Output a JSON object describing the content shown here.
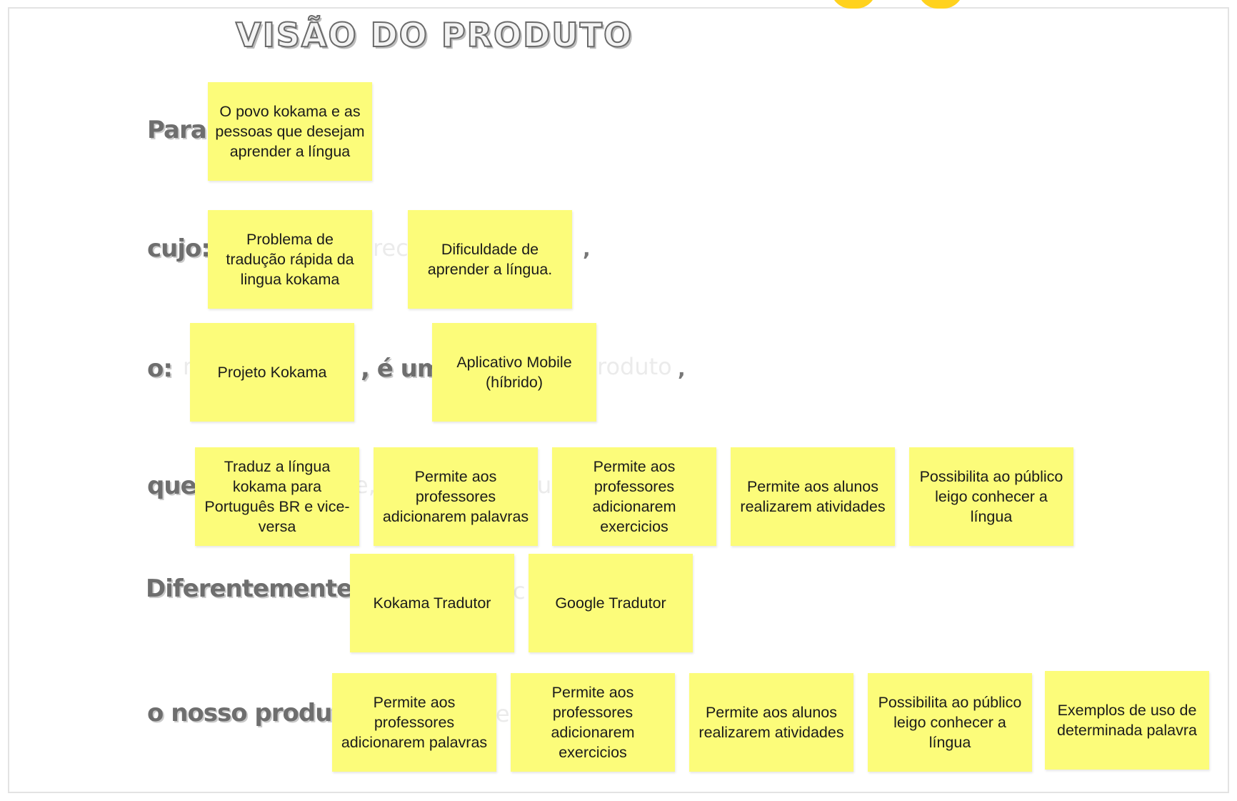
{
  "title": "VISÃO DO PRODUTO",
  "labels": {
    "para": "Para:",
    "cujo": "cujo:",
    "o": "o:",
    "e_um": ", é um:",
    "que": "que:",
    "diferentemente": "Diferentemente da:",
    "nosso_produto": "o nosso produto:"
  },
  "commas": {
    "cujo_end": ",",
    "eum_end": ","
  },
  "ghosts": {
    "cujo": "rec",
    "o_mid": "n",
    "eum_end": "roduto",
    "que_a": "e,",
    "que_b": "u",
    "dif": "c",
    "nosso": "e"
  },
  "colors": {
    "sticky": "#fcfc7a",
    "label": "#6e6e6e",
    "deco": "#ffd21e"
  },
  "notes": {
    "para": [
      "O povo kokama e as pessoas que desejam aprender a língua"
    ],
    "cujo": [
      "Problema de tradução rápida da lingua kokama",
      "Dificuldade de aprender a língua."
    ],
    "o": [
      "Projeto Kokama"
    ],
    "e_um": [
      "Aplicativo Mobile (híbrido)"
    ],
    "que": [
      "Traduz a língua kokama para Português BR e vice-versa",
      "Permite aos professores adicionarem palavras",
      "Permite aos professores adicionarem exercicios",
      "Permite aos alunos realizarem atividades",
      "Possibilita ao público leigo conhecer a língua"
    ],
    "diferentemente": [
      "Kokama Tradutor",
      "Google Tradutor"
    ],
    "nosso_produto": [
      "Permite aos professores adicionarem palavras",
      "Permite aos professores adicionarem exercicios",
      "Permite aos alunos realizarem atividades",
      "Possibilita ao público leigo conhecer a língua",
      "Exemplos de uso de determinada palavra"
    ]
  }
}
